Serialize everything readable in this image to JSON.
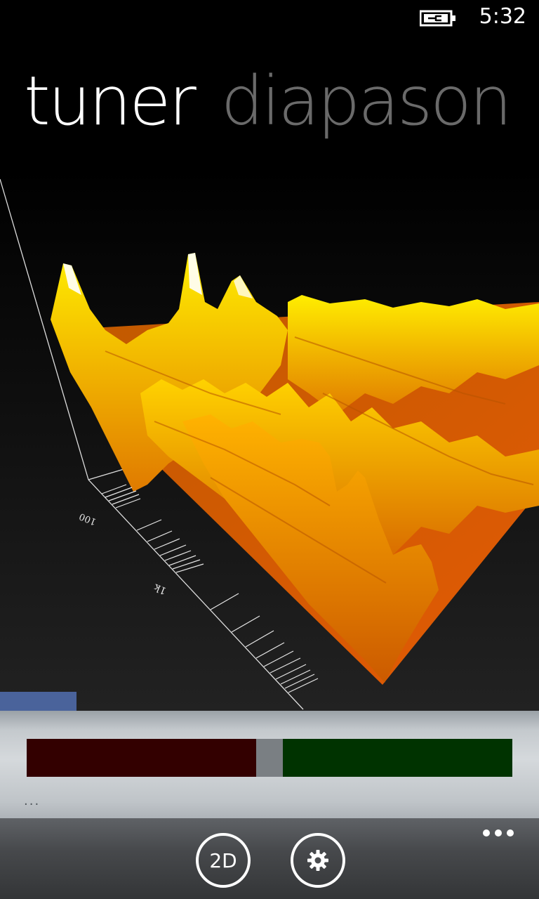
{
  "status_bar": {
    "time": "5:32",
    "battery_icon": "battery-charging-icon"
  },
  "pivot": {
    "items": [
      {
        "label": "tuner",
        "selected": true
      },
      {
        "label": "diapason",
        "selected": false
      }
    ]
  },
  "spectrogram": {
    "axis_labels": [
      "100",
      "1k"
    ],
    "colors": {
      "low": "#d94a00",
      "mid": "#ff8c00",
      "high": "#ffe600",
      "peak": "#ffffff"
    }
  },
  "tuner": {
    "note_readout": "...",
    "colors": {
      "flat": "#330000",
      "center": "#7a7f83",
      "sharp": "#003300"
    }
  },
  "app_bar": {
    "button_2d_label": "2D",
    "settings_icon": "gear-icon",
    "more_icon": "ellipsis-icon"
  },
  "accent_color": "#4a639b"
}
